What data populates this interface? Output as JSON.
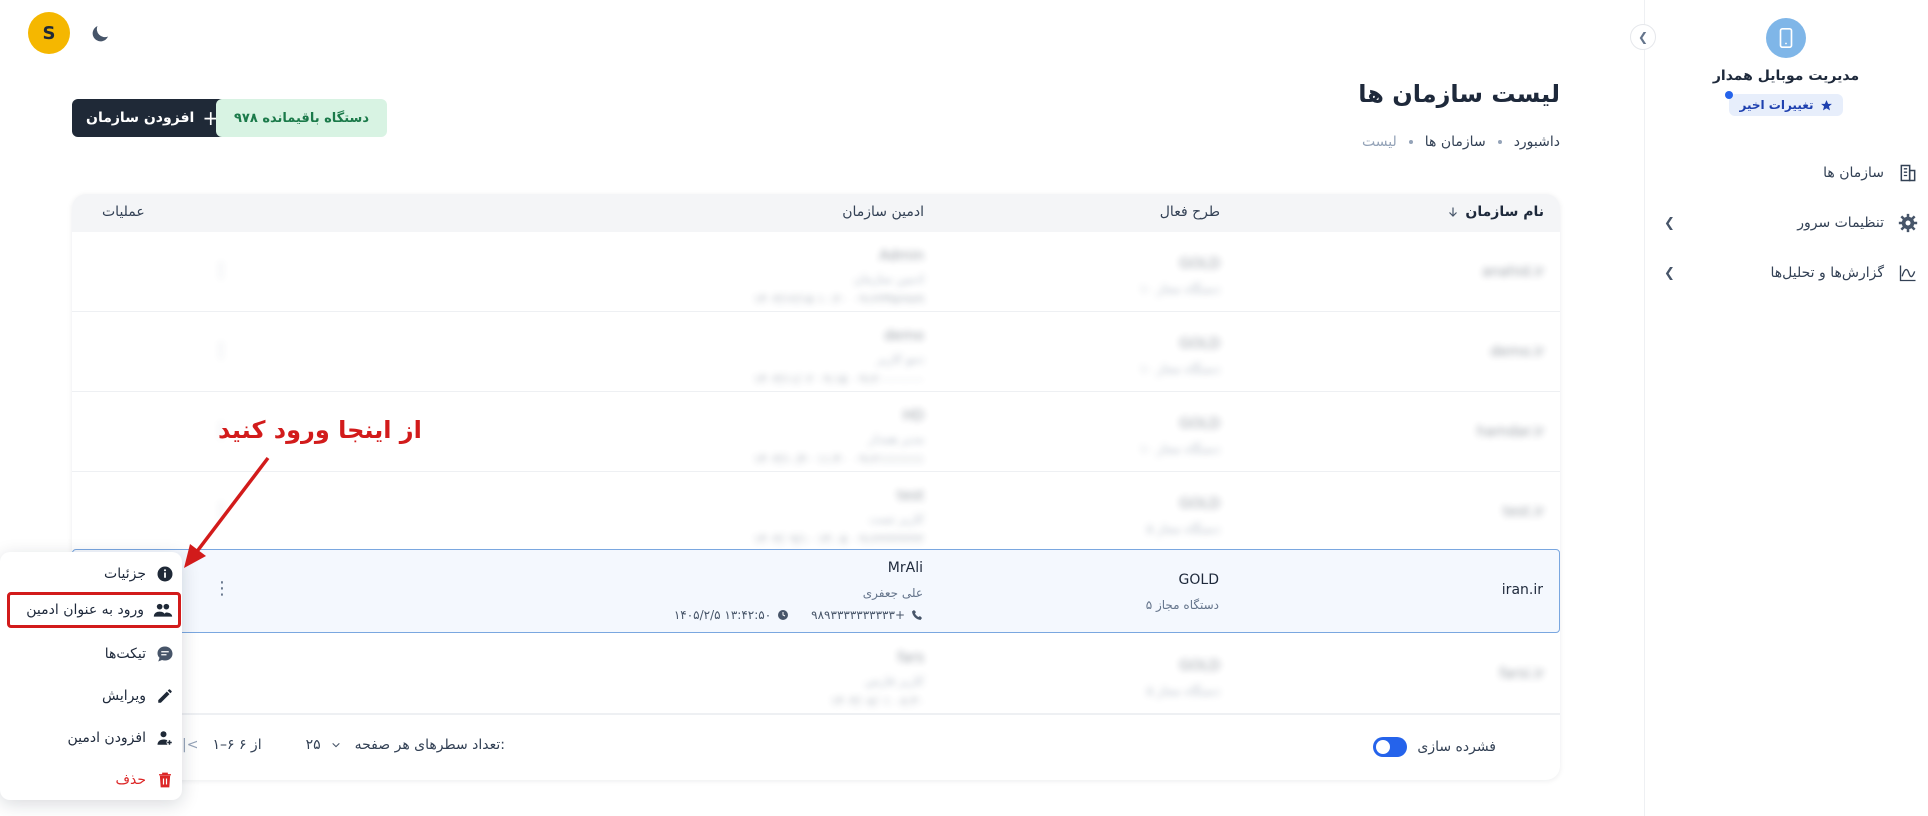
{
  "app": {
    "title": "مدیریت موبایل همدار",
    "recent_changes": "تغییرات اخیر",
    "avatar_letter": "S"
  },
  "sidebar": {
    "items": [
      {
        "label": "سازمان ها",
        "icon": "building-icon"
      },
      {
        "label": "تنظیمات سرور",
        "icon": "gear-icon"
      },
      {
        "label": "گزارش‌ها و تحلیل‌ها",
        "icon": "chart-line-icon"
      }
    ]
  },
  "header": {
    "title": "لیست سازمان ها",
    "breadcrumb": [
      "داشبورد",
      "سازمان ها",
      "لیست"
    ],
    "add_button": "افزودن سازمان",
    "devices_remaining": "۹۷۸ دستگاه باقیمانده"
  },
  "table": {
    "columns": {
      "name": "نام سازمان",
      "plan": "طرح فعال",
      "admin": "ادمین سازمان",
      "ops": "عملیات"
    },
    "blurred_rows": [
      {
        "org": "anahid.ir",
        "plan": "GOLD",
        "plan_sub": "۱۰ دستگاه مجاز",
        "user": "Admin",
        "name": "ادمین سازمان",
        "phone": "۰۹۱۲۳۴۵۶۷۸۹",
        "time": "۱۴۰۳/۱۲/۱۵ ۱۰:۲۰"
      },
      {
        "org": "demo.ir",
        "plan": "GOLD",
        "plan_sub": "۱۰ دستگاه مجاز",
        "user": "demo",
        "name": "دمو کاربر",
        "phone": "۰۹۱۲۰۰۰۰۰۰۰",
        "time": "۱۴۰۳/۱۱/۰۲ ۰۹:۱۵"
      },
      {
        "org": "hamdar.ir",
        "plan": "GOLD",
        "plan_sub": "۱۰ دستگاه مجاز",
        "user": "HD",
        "name": "مدیر همدار",
        "phone": "۰۹۱۲۱۱۱۱۱۱۱",
        "time": "۱۴۰۳/۱۰/۲۰ ۱۱:۴۰"
      },
      {
        "org": "test.ir",
        "plan": "GOLD",
        "plan_sub": "۵ دستگاه مجاز",
        "user": "test",
        "name": "کاربر تست",
        "phone": "۰۹۱۲۲۲۲۲۲۲۲",
        "time": "۱۴۰۳/۰۹/۱۰ ۱۴:۰۵"
      }
    ],
    "active_row": {
      "org": "iran.ir",
      "plan": "GOLD",
      "plan_sub": "۵ دستگاه مجاز",
      "user": "MrAli",
      "name": "علی جعفری",
      "phone": "۹۸۹۳۳۳۳۳۳۳۳۳۳+",
      "time": "۱۴۰۵/۲/۵ ۱۳:۴۲:۵۰"
    },
    "last_row": {
      "org": "farsi.ir",
      "plan": "GOLD",
      "plan_sub": "۵ دستگاه مجاز",
      "user": "fars",
      "name": "کاربر فارس",
      "phone": "",
      "time": "۱۴۰۳/۰۸/۰۱ ۰۸:۳۰"
    }
  },
  "footer": {
    "dense_label": "فشرده سازی",
    "rows_per_page_label": "تعداد سطرهای هر صفحه:",
    "rows_per_page_value": "۲۵",
    "range": "۱–۶ از ۶"
  },
  "menu": {
    "items": [
      {
        "label": "جزئیات",
        "icon": "info-icon"
      },
      {
        "label": "ورود به عنوان ادمین",
        "icon": "users-icon"
      },
      {
        "label": "تیکت‌ها",
        "icon": "chat-icon"
      },
      {
        "label": "ویرایش",
        "icon": "pencil-icon"
      },
      {
        "label": "افزودن ادمین",
        "icon": "user-add-icon"
      },
      {
        "label": "حذف",
        "icon": "trash-icon"
      }
    ]
  },
  "annotation": {
    "text": "از اینجا ورود کنید",
    "color": "#d21b1b"
  },
  "colors": {
    "accent": "#2563eb",
    "dark_button": "#1f2937",
    "success_bg": "#d8f3e3",
    "danger": "#dc2626"
  }
}
